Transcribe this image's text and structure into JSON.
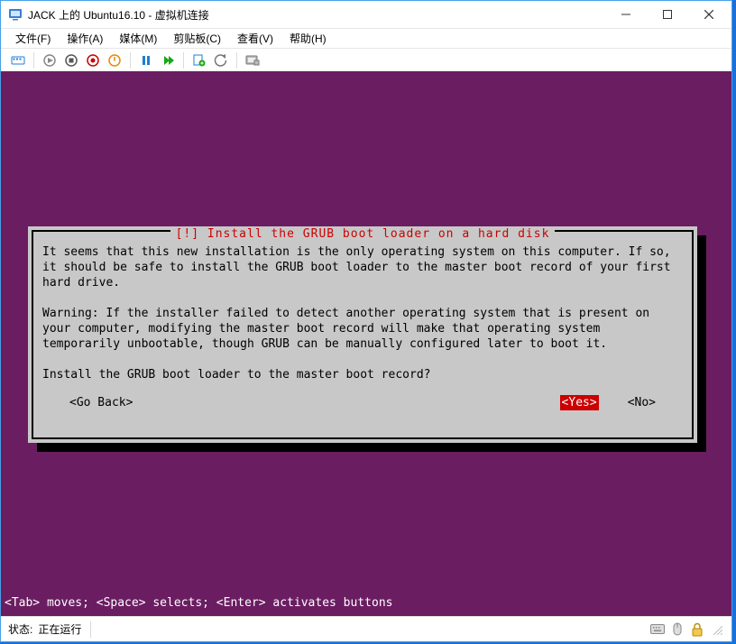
{
  "window": {
    "title": "JACK 上的 Ubuntu16.10 - 虚拟机连接"
  },
  "menu": {
    "file": "文件(F)",
    "action": "操作(A)",
    "media": "媒体(M)",
    "clipboard": "剪贴板(C)",
    "view": "查看(V)",
    "help": "帮助(H)"
  },
  "dialog": {
    "title": "[!] Install the GRUB boot loader on a hard disk",
    "body": "It seems that this new installation is the only operating system on this computer. If so, it should be safe to install the GRUB boot loader to the master boot record of your first hard drive.\n\nWarning: If the installer failed to detect another operating system that is present on your computer, modifying the master boot record will make that operating system temporarily unbootable, though GRUB can be manually configured later to boot it.\n\nInstall the GRUB boot loader to the master boot record?",
    "go_back": "<Go Back>",
    "yes": "<Yes>",
    "no": "<No>"
  },
  "hint": "<Tab> moves; <Space> selects; <Enter> activates buttons",
  "status": {
    "label": "状态:",
    "value": "正在运行"
  }
}
